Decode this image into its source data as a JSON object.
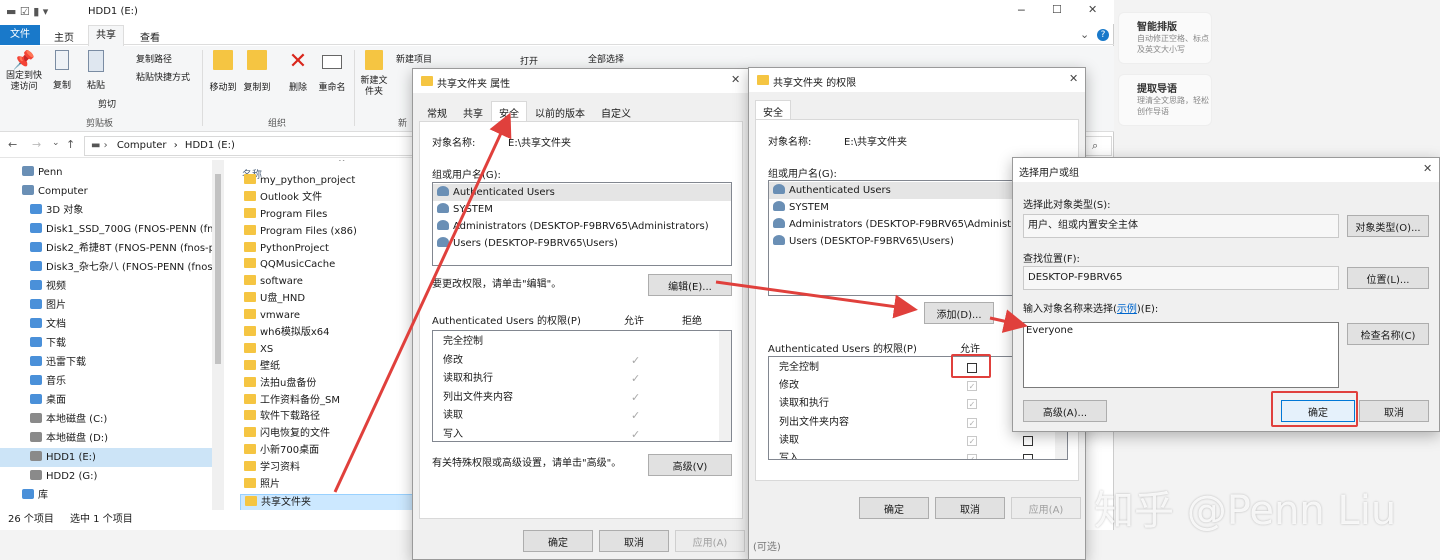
{
  "explorer": {
    "title": "HDD1 (E:)",
    "file_tab": "文件",
    "tabs": [
      "主页",
      "共享",
      "查看"
    ],
    "ribbon": {
      "pin": "固定到快速访问",
      "copy": "复制",
      "paste": "粘贴",
      "copy_path": "复制路径",
      "paste_shortcut": "粘贴快捷方式",
      "cut": "剪切",
      "clipboard_group": "剪贴板",
      "move_to": "移动到",
      "copy_to": "复制到",
      "delete": "删除",
      "rename": "重命名",
      "organize_group": "组织",
      "new_folder": "新建文件夹",
      "new_item": "新建项目",
      "open": "打开",
      "select_all": "全部选择",
      "new_group": "新"
    },
    "breadcrumb": [
      "Computer",
      "HDD1 (E:)"
    ],
    "nav": [
      "Penn",
      "Computer",
      "3D 对象",
      "Disk1_SSD_700G (FNOS-PENN (fnos-",
      "Disk2_希捷8T (FNOS-PENN (fnos-pe",
      "Disk3_杂七杂八 (FNOS-PENN (fnos-",
      "视频",
      "图片",
      "文档",
      "下载",
      "迅雷下载",
      "音乐",
      "桌面",
      "本地磁盘 (C:)",
      "本地磁盘 (D:)",
      "HDD1 (E:)",
      "HDD2 (G:)",
      "库"
    ],
    "column_name": "名称",
    "files": [
      "my_python_project",
      "Outlook 文件",
      "Program Files",
      "Program Files (x86)",
      "PythonProject",
      "QQMusicCache",
      "software",
      "U盘_HND",
      "vmware",
      "wh6模拟版x64",
      "XS",
      "壁纸",
      "法拍u盘备份",
      "工作资料备份_SM",
      "软件下载路径",
      "闪电恢复的文件",
      "小新700桌面",
      "学习资料",
      "照片",
      "共享文件夹"
    ],
    "status_items": "26 个项目",
    "status_selected": "选中 1 个项目"
  },
  "side_panel": {
    "t1": "智能排版",
    "d1": "自动修正空格、标点及英文大小写",
    "t2": "提取导语",
    "d2": "理清全文思路，轻松创作导语"
  },
  "props": {
    "title": "共享文件夹 属性",
    "tabs": [
      "常规",
      "共享",
      "安全",
      "以前的版本",
      "自定义"
    ],
    "object_label": "对象名称:",
    "object_value": "E:\\共享文件夹",
    "group_label": "组或用户名(G):",
    "users": [
      "Authenticated Users",
      "SYSTEM",
      "Administrators (DESKTOP-F9BRV65\\Administrators)",
      "Users (DESKTOP-F9BRV65\\Users)"
    ],
    "change_hint": "要更改权限，请单击\"编辑\"。",
    "edit_btn": "编辑(E)...",
    "perm_title": "Authenticated Users 的权限(P)",
    "allow": "允许",
    "deny": "拒绝",
    "perms": [
      "完全控制",
      "修改",
      "读取和执行",
      "列出文件夹内容",
      "读取",
      "写入"
    ],
    "adv_hint": "有关特殊权限或高级设置，请单击\"高级\"。",
    "adv_btn": "高级(V)",
    "ok": "确定",
    "cancel": "取消",
    "apply": "应用(A)"
  },
  "perm_dlg": {
    "title": "共享文件夹 的权限",
    "tab": "安全",
    "object_label": "对象名称:",
    "object_value": "E:\\共享文件夹",
    "group_label": "组或用户名(G):",
    "users": [
      "Authenticated Users",
      "SYSTEM",
      "Administrators (DESKTOP-F9BRV65\\Administrato",
      "Users (DESKTOP-F9BRV65\\Users)"
    ],
    "add_btn": "添加(D)...",
    "perm_title": "Authenticated Users 的权限(P)",
    "allow": "允许",
    "perms": [
      "完全控制",
      "修改",
      "读取和执行",
      "列出文件夹内容",
      "读取",
      "写入"
    ],
    "ok": "确定",
    "cancel": "取消",
    "apply": "应用(A)",
    "footer": "(可选)"
  },
  "select_dlg": {
    "title": "选择用户或组",
    "type_label": "选择此对象类型(S):",
    "type_value": "用户、组或内置安全主体",
    "type_btn": "对象类型(O)...",
    "loc_label": "查找位置(F):",
    "loc_value": "DESKTOP-F9BRV65",
    "loc_btn": "位置(L)...",
    "enter_label": "输入对象名称来选择(",
    "enter_link": "示例",
    "enter_label_end": ")(E):",
    "enter_value": "Everyone",
    "check_btn": "检查名称(C)",
    "adv_btn": "高级(A)...",
    "ok": "确定",
    "cancel": "取消"
  },
  "watermark": "知乎 @Penn Liu"
}
